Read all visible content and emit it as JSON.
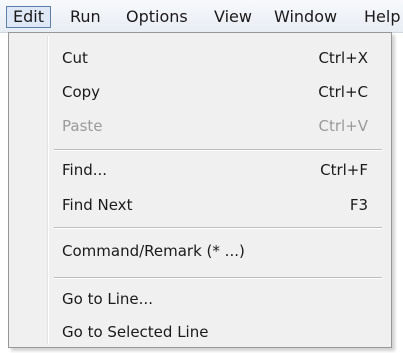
{
  "menubar": {
    "items": [
      {
        "label": "Edit"
      },
      {
        "label": "Run"
      },
      {
        "label": "Options"
      },
      {
        "label": "View"
      },
      {
        "label": "Window"
      },
      {
        "label": "Help"
      }
    ]
  },
  "edit_menu": {
    "items": [
      {
        "label": "Cut",
        "shortcut": "Ctrl+X",
        "enabled": true
      },
      {
        "label": "Copy",
        "shortcut": "Ctrl+C",
        "enabled": true
      },
      {
        "label": "Paste",
        "shortcut": "Ctrl+V",
        "enabled": false
      },
      {
        "label": "Find...",
        "shortcut": "Ctrl+F",
        "enabled": true
      },
      {
        "label": "Find Next",
        "shortcut": "F3",
        "enabled": true
      },
      {
        "label": "Command/Remark (* ...)",
        "shortcut": "",
        "enabled": true
      },
      {
        "label": "Go to Line...",
        "shortcut": "",
        "enabled": true
      },
      {
        "label": "Go to Selected Line",
        "shortcut": "",
        "enabled": true
      }
    ]
  },
  "colors": {
    "menubar_bg": "#e8edf4",
    "menu_bg": "#f0f0f0",
    "active_item_border": "#5d7fa8",
    "disabled_text": "#9a9a9a"
  }
}
